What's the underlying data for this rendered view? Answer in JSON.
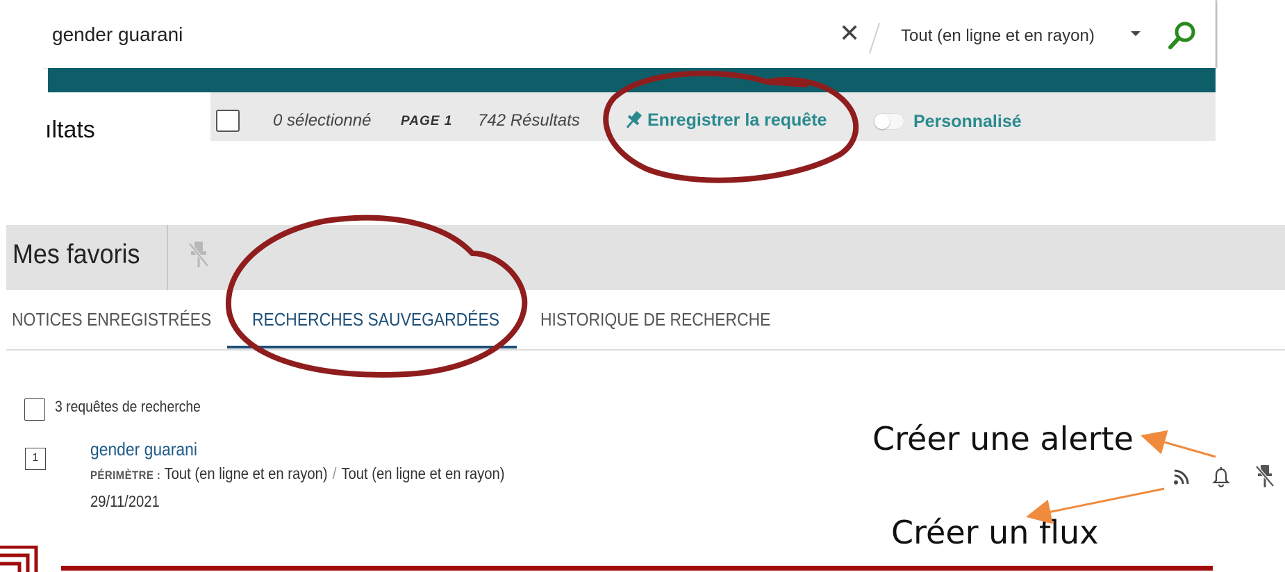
{
  "search": {
    "query": "gender guarani",
    "clear_symbol": "✕",
    "scope_selected": "Tout (en ligne et en rayon)"
  },
  "results_toolbar": {
    "heading_partial": "ıltats",
    "selected_count": "0 sélectionné",
    "page_label": "PAGE 1",
    "results_count": "742 Résultats",
    "save_query_label": "Enregistrer la requête",
    "personalized_label": "Personnalisé",
    "personalized_on": false
  },
  "favorites": {
    "title": "Mes favoris",
    "tabs": [
      {
        "label": "NOTICES ENREGISTRÉES",
        "active": false
      },
      {
        "label": "RECHERCHES SAUVEGARDÉES",
        "active": true
      },
      {
        "label": "HISTORIQUE DE RECHERCHE",
        "active": false
      }
    ],
    "count_label": "3 requêtes de recherche",
    "items": [
      {
        "index": "1",
        "title": "gender guarani",
        "scope_key": "PÉRIMÈTRE :",
        "scope_value_1": "Tout (en ligne et en rayon)",
        "scope_separator": "/",
        "scope_value_2": "Tout (en ligne et en rayon)",
        "date": "29/11/2021"
      }
    ]
  },
  "annotations": {
    "alert": "Créer une alerte",
    "feed": "Créer un flux"
  },
  "icons": {
    "search": "search-icon",
    "clear": "close-icon",
    "caret": "chevron-down-icon",
    "pin": "pin-icon",
    "unpin": "unpin-icon",
    "rss": "rss-icon",
    "bell": "bell-icon"
  },
  "colors": {
    "teal_band": "#0e5e6a",
    "teal_link": "#2a8a8e",
    "search_green": "#2a8a1e",
    "tab_active": "#1e4f78",
    "annotation_circle": "#8f1d1d",
    "annotation_arrow": "#f08a3c",
    "footer_rule": "#a00c0c"
  }
}
